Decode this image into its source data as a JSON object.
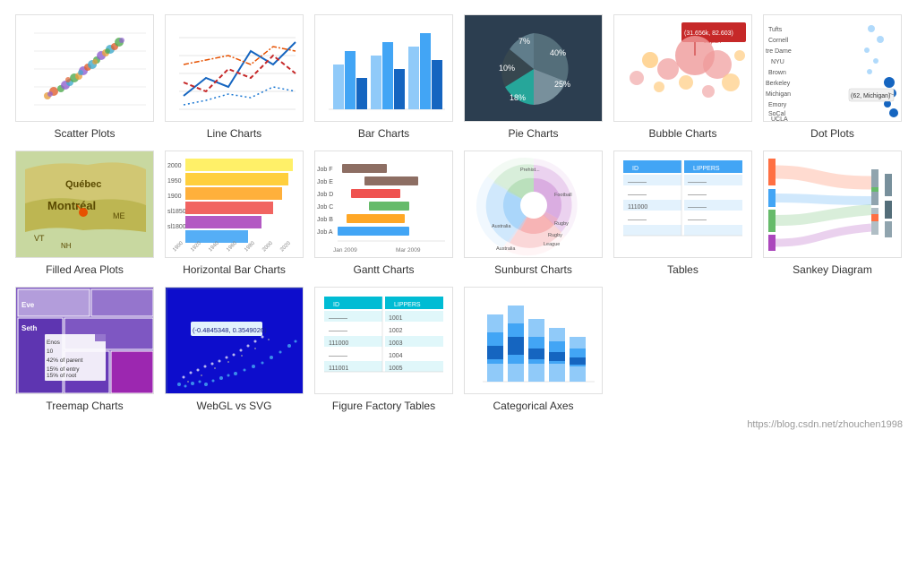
{
  "gallery": {
    "items": [
      {
        "id": "scatter",
        "label": "Scatter Plots"
      },
      {
        "id": "line",
        "label": "Line Charts"
      },
      {
        "id": "bar",
        "label": "Bar Charts"
      },
      {
        "id": "pie",
        "label": "Pie Charts"
      },
      {
        "id": "bubble",
        "label": "Bubble Charts"
      },
      {
        "id": "dot",
        "label": "Dot Plots"
      },
      {
        "id": "farea",
        "label": "Filled Area Plots"
      },
      {
        "id": "hbar",
        "label": "Horizontal Bar Charts"
      },
      {
        "id": "gantt",
        "label": "Gantt Charts"
      },
      {
        "id": "sunburst",
        "label": "Sunburst Charts"
      },
      {
        "id": "table",
        "label": "Tables"
      },
      {
        "id": "sankey",
        "label": "Sankey Diagram"
      },
      {
        "id": "treemap",
        "label": "Treemap Charts"
      },
      {
        "id": "webgl",
        "label": "WebGL vs SVG"
      },
      {
        "id": "ff",
        "label": "Figure Factory Tables"
      },
      {
        "id": "cat",
        "label": "Categorical Axes"
      }
    ],
    "footer": "https://blog.csdn.net/zhouchen1998"
  }
}
